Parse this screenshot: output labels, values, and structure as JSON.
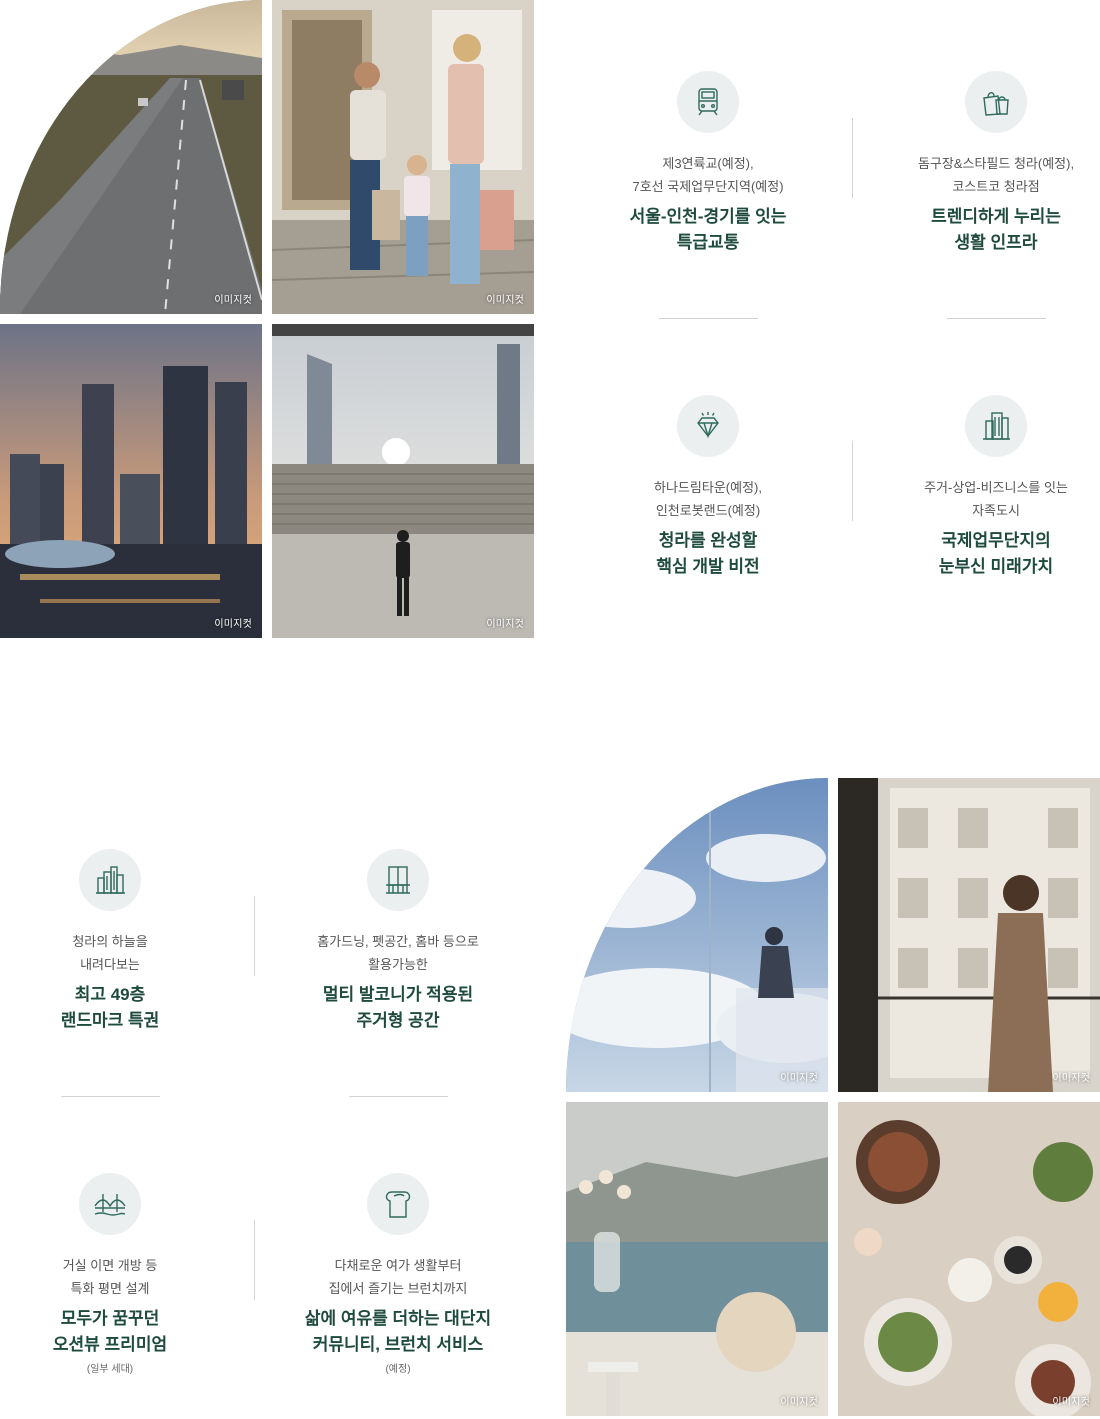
{
  "image_caption": "이미지컷",
  "section1": {
    "features": [
      {
        "icon": "train-icon",
        "desc": "제3연륙교(예정),\n7호선 국제업무단지역(예정)",
        "head": "서울-인천-경기를 잇는\n특급교통"
      },
      {
        "icon": "shopping-bags-icon",
        "desc": "돔구장&스타필드 청라(예정),\n코스트코 청라점",
        "head": "트렌디하게 누리는\n생활 인프라"
      },
      {
        "icon": "diamond-icon",
        "desc": "하나드림타운(예정),\n인천로봇랜드(예정)",
        "head": "청라를 완성할\n핵심 개발 비전"
      },
      {
        "icon": "office-buildings-icon",
        "desc": "주거-상업-비즈니스를 잇는\n자족도시",
        "head": "국제업무단지의\n눈부신 미래가치"
      }
    ]
  },
  "section2": {
    "features": [
      {
        "icon": "city-skyline-icon",
        "desc": "청라의 하늘을\n내려다보는",
        "head": "최고 49층\n랜드마크 특권"
      },
      {
        "icon": "balcony-window-icon",
        "desc": "홈가드닝, 펫공간, 홈바 등으로\n활용가능한",
        "head": "멀티 발코니가 적용된\n주거형 공간"
      },
      {
        "icon": "bridge-icon",
        "desc": "거실 이면 개방 등\n특화 평면 설계",
        "head": "모두가 꿈꾸던\n오션뷰 프리미엄",
        "note": "(일부 세대)"
      },
      {
        "icon": "bread-icon",
        "desc": "다채로운 여가 생활부터\n집에서 즐기는 브런치까지",
        "head": "삶에 여유를 더하는 대단지\n커뮤니티, 브런치 서비스",
        "note": "(예정)"
      }
    ]
  },
  "colors": {
    "heading": "#1f4b3f",
    "icon_stroke": "#2f6b5c",
    "icon_bg": "#ecefef",
    "divider": "#d3d3d3"
  }
}
